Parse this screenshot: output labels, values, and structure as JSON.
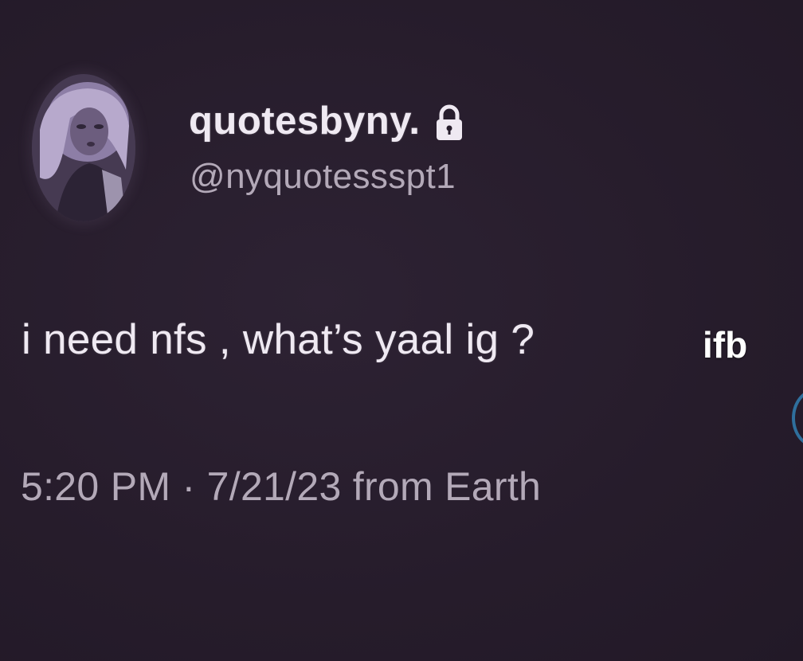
{
  "tweet": {
    "display_name": "quotesbyny.",
    "handle": "@nyquotessspt1",
    "text": "i need nfs , what’s yaal ig ?",
    "timestamp": "5:20 PM · 7/21/23 from Earth"
  },
  "overlay": {
    "caption": "ifb"
  },
  "icons": {
    "lock": "lock-icon",
    "avatar": "avatar-image"
  },
  "colors": {
    "background": "#271d2c",
    "primary_text": "#efe9f2",
    "secondary_text": "#b3a9b8",
    "edge_ring": "#2f6f9c"
  }
}
